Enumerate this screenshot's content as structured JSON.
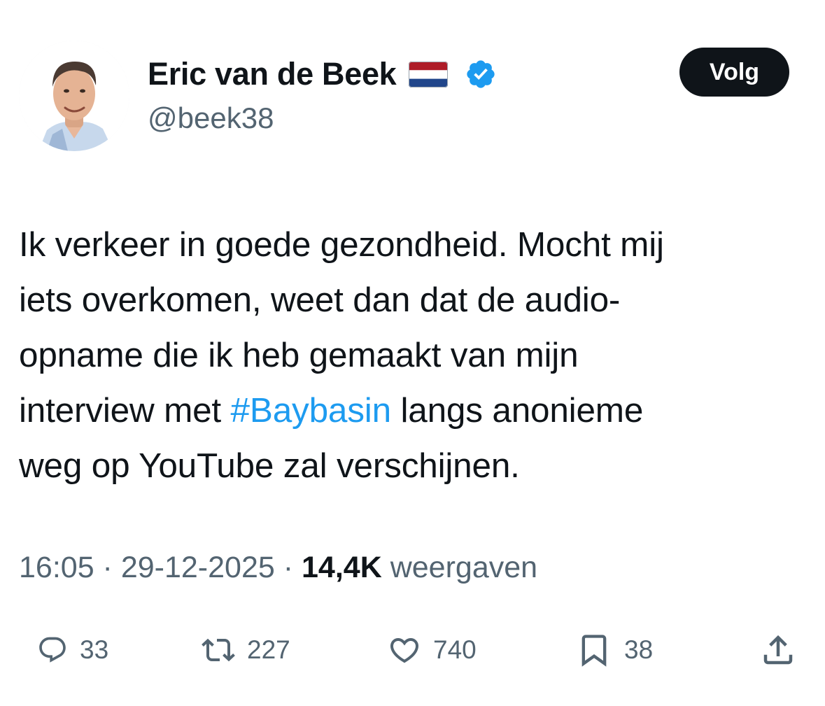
{
  "author": {
    "display_name": "Eric van de Beek",
    "handle": "@beek38",
    "flag_icon": "netherlands-flag-icon",
    "verified_icon": "verified-badge-icon",
    "verified_color": "#1d9bf0"
  },
  "follow_button": {
    "label": "Volg"
  },
  "tweet": {
    "line1": "Ik verkeer in goede gezondheid. Mocht mij",
    "line2": "iets overkomen, weet dan dat de audio-",
    "line3": "opname die ik heb gemaakt van mijn",
    "line4_before": "interview met ",
    "hashtag": "#Baybasin",
    "line4_after": " langs anonieme",
    "line5": "weg op YouTube zal verschijnen."
  },
  "meta": {
    "time": "16:05",
    "separator": " · ",
    "date": "29-12-2025",
    "views_count": "14,4K",
    "views_label": " weergaven"
  },
  "actions": {
    "replies": {
      "icon": "reply-icon",
      "count": "33"
    },
    "reposts": {
      "icon": "repost-icon",
      "count": "227"
    },
    "likes": {
      "icon": "heart-icon",
      "count": "740"
    },
    "bookmarks": {
      "icon": "bookmark-icon",
      "count": "38"
    },
    "share": {
      "icon": "share-icon"
    }
  },
  "colors": {
    "text": "#0f1419",
    "secondary": "#536471",
    "link": "#1d9bf0",
    "button_bg": "#0f1419"
  }
}
